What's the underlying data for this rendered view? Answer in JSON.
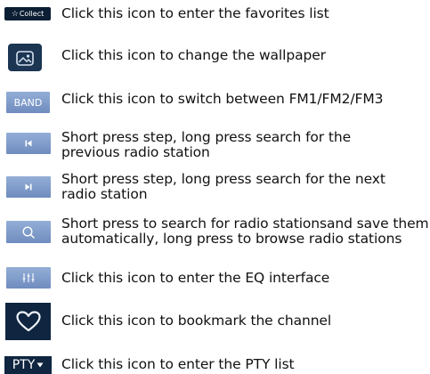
{
  "items": [
    {
      "icon": "star-icon",
      "icon_label": "Collect",
      "lines": [
        "Click this icon to enter the favorites list"
      ]
    },
    {
      "icon": "wallpaper-icon",
      "lines": [
        "Click this icon to change the wallpaper"
      ]
    },
    {
      "icon": "band-icon",
      "icon_label": "BAND",
      "lines": [
        "Click this icon to switch between FM1/FM2/FM3"
      ]
    },
    {
      "icon": "previous-track-icon",
      "lines": [
        "Short press step, long press search for the",
        "previous radio station"
      ]
    },
    {
      "icon": "next-track-icon",
      "lines": [
        "Short press step, long press search for the next",
        "radio station"
      ]
    },
    {
      "icon": "search-icon",
      "lines": [
        "Short press to search for radio stationsand save them",
        "automatically, long press to browse radio stations"
      ]
    },
    {
      "icon": "equalizer-icon",
      "lines": [
        "Click this icon to enter the EQ interface"
      ]
    },
    {
      "icon": "heart-icon",
      "lines": [
        "Click this icon to bookmark the channel"
      ]
    },
    {
      "icon": "pty-icon",
      "icon_label": "PTY",
      "lines": [
        "Click this icon to enter the PTY list"
      ]
    }
  ],
  "colors": {
    "button_blue": "#7f9acb",
    "dark_navy": "#0f2540",
    "text": "#111111"
  }
}
